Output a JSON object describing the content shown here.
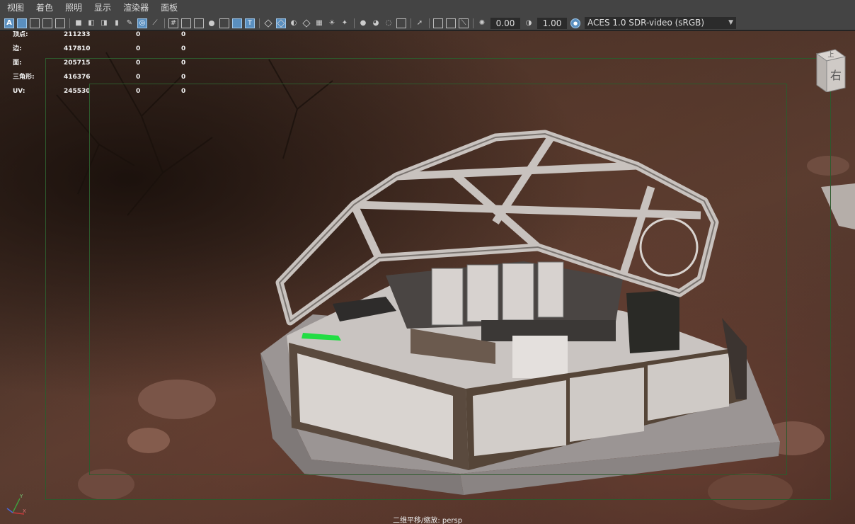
{
  "menubar": {
    "items": [
      "视图",
      "着色",
      "照明",
      "显示",
      "渲染器",
      "面板"
    ]
  },
  "toolbar": {
    "exposure": "0.00",
    "gamma": "1.00",
    "color_management": "ACES 1.0 SDR-video (sRGB)"
  },
  "hud": {
    "rows": [
      {
        "label": "顶点:",
        "v1": "211233",
        "v2": "0",
        "v3": "0"
      },
      {
        "label": "边:",
        "v1": "417810",
        "v2": "0",
        "v3": "0"
      },
      {
        "label": "面:",
        "v1": "205715",
        "v2": "0",
        "v3": "0"
      },
      {
        "label": "三角形:",
        "v1": "416376",
        "v2": "0",
        "v3": "0"
      },
      {
        "label": "UV:",
        "v1": "245530",
        "v2": "0",
        "v3": "0"
      }
    ]
  },
  "viewcube": {
    "top_label": "上",
    "right_label": "右"
  },
  "axis": {
    "y": "Y",
    "x": "X"
  },
  "status": "二维平移/缩放: persp"
}
